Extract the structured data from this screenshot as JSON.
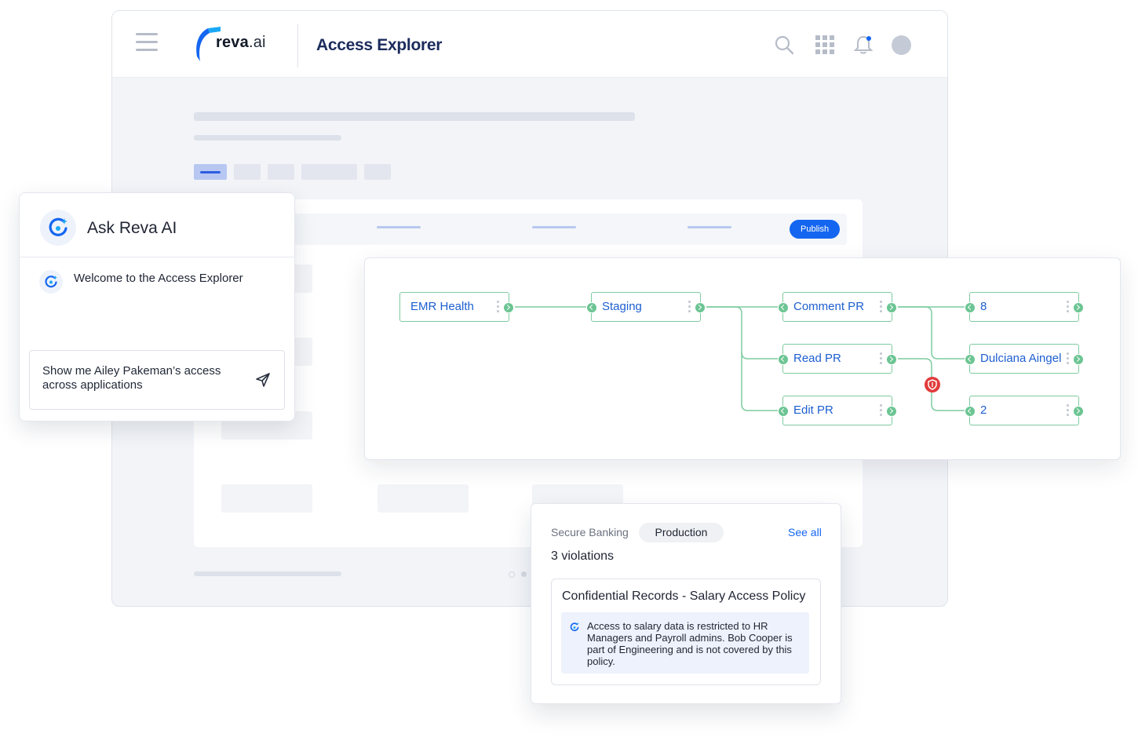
{
  "header": {
    "logo_text": "reva",
    "logo_suffix": ".ai",
    "title": "Access Explorer",
    "icons": [
      "menu-icon",
      "search-icon",
      "apps-grid-icon",
      "bell-icon",
      "avatar"
    ]
  },
  "main": {
    "publish_label": "Publish"
  },
  "ask_panel": {
    "title": "Ask Reva AI",
    "welcome": "Welcome to the Access Explorer",
    "prompt": "Show me Ailey Pakeman’s access across applications",
    "icons": [
      "reva-ai-icon",
      "send-icon"
    ]
  },
  "graph": {
    "nodes": [
      {
        "label": "EMR Health"
      },
      {
        "label": "Staging"
      },
      {
        "label": "Comment PR"
      },
      {
        "label": "Read PR"
      },
      {
        "label": "Edit PR"
      },
      {
        "label": "8"
      },
      {
        "label": "Dulciana Aingel"
      },
      {
        "label": "2"
      }
    ],
    "violation_icon": "shield-icon"
  },
  "violations": {
    "app": "Secure Banking",
    "environment": "Production",
    "see_all": "See all",
    "count": "3 violations",
    "policy_title": "Confidential Records - Salary Access Policy",
    "ai_note": "Access to salary data is restricted to HR Managers and Payroll admins. Bob Cooper is part of Engineering and is not covered by this policy."
  },
  "colors": {
    "accent": "#1466f0",
    "node_border": "#7ecba0",
    "node_text": "#1d5fd0",
    "violation": "#e13b3b",
    "title": "#1b2b5c"
  }
}
